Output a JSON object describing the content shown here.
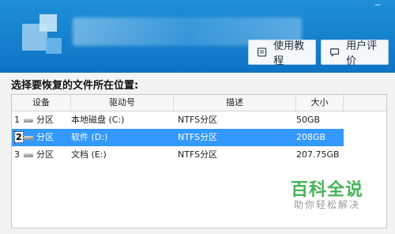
{
  "window": {
    "close_glyph": "─"
  },
  "header": {
    "buttons": [
      {
        "label": "使用教程",
        "icon": "book-icon"
      },
      {
        "label": "用户评价",
        "icon": "comment-icon"
      }
    ]
  },
  "prompt": "选择要恢复的文件所在位置:",
  "table": {
    "columns": [
      "设备",
      "驱动号",
      "描述",
      "大小"
    ],
    "rows": [
      {
        "index": "1",
        "device": "分区",
        "drive": "本地磁盘 (C:)",
        "description": "NTFS分区",
        "size": "50GB",
        "selected": false
      },
      {
        "index": "2",
        "device": "分区",
        "drive": "软件 (D:)",
        "description": "NTFS分区",
        "size": "208GB",
        "selected": true
      },
      {
        "index": "3",
        "device": "分区",
        "drive": "文档 (E:)",
        "description": "NTFS分区",
        "size": "207.75GB",
        "selected": false
      }
    ]
  },
  "watermark": {
    "title": "百科全说",
    "subtitle": "助你轻松解决"
  },
  "colors": {
    "header": "#1683d0",
    "selection": "#3399ff",
    "watermark": "#47b35a"
  }
}
